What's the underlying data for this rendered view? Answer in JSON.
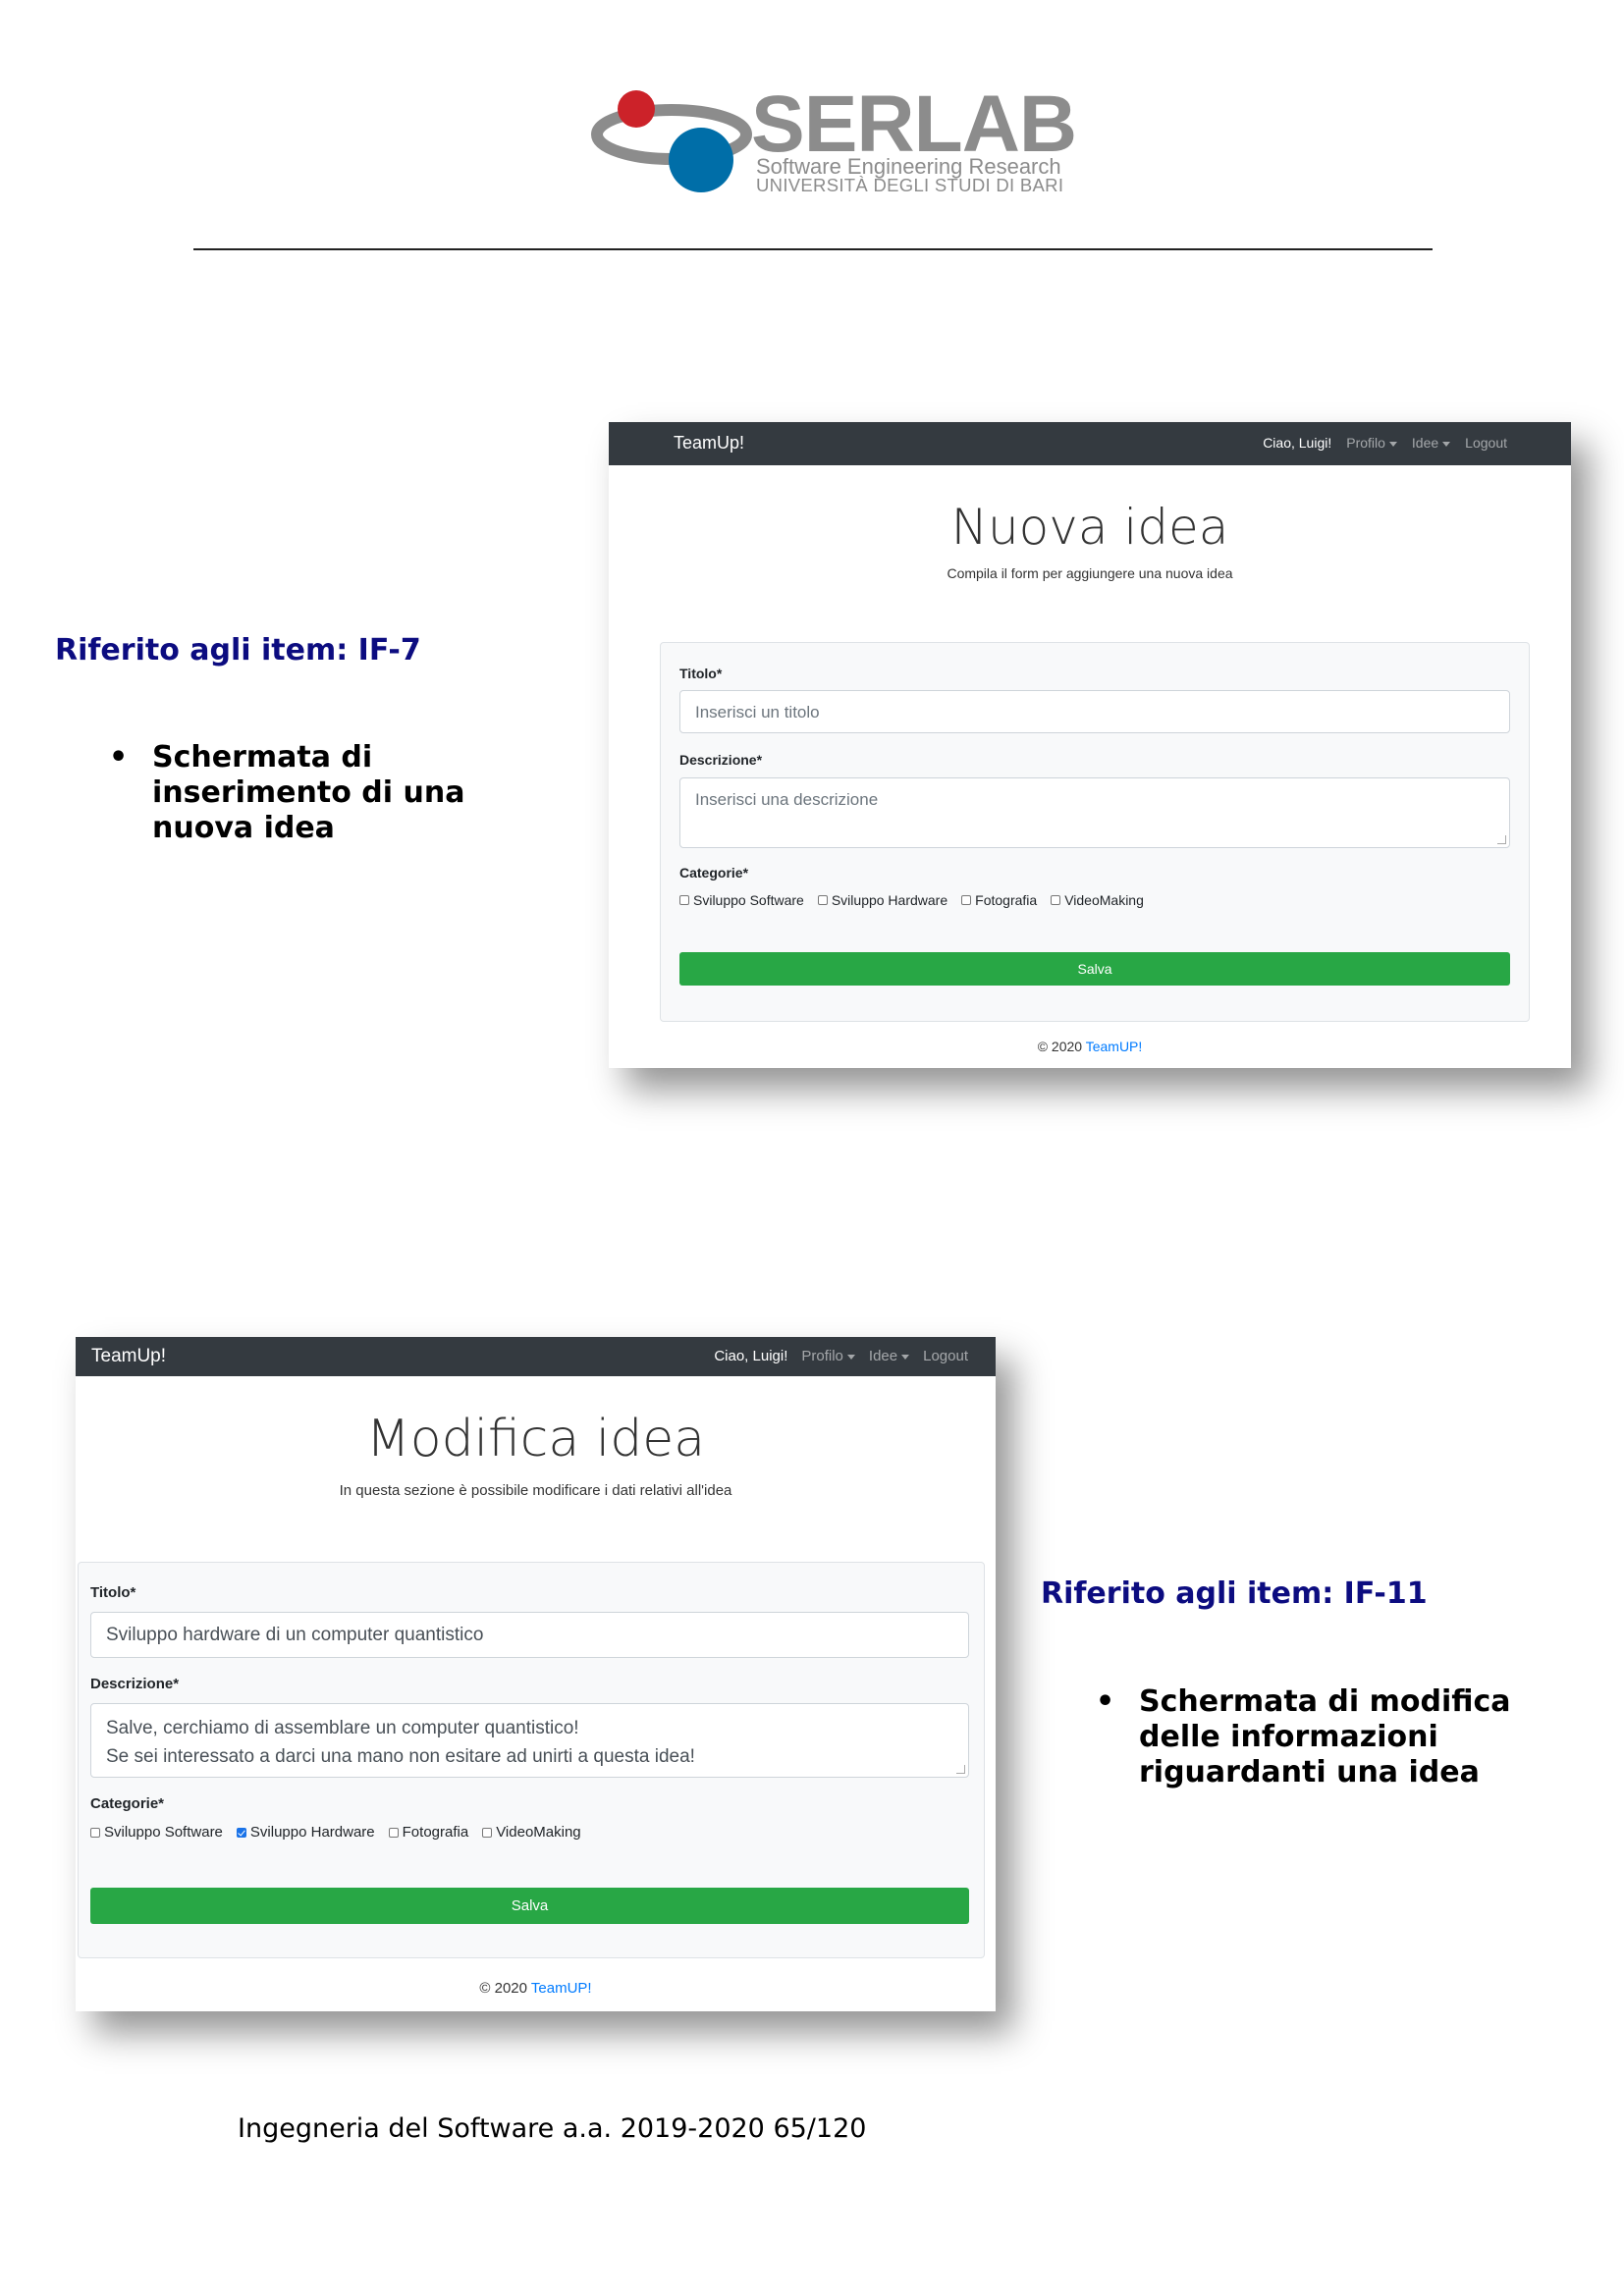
{
  "logo": {
    "name": "SERLAB",
    "subtitle_1": "Software Engineering Research",
    "subtitle_2": "UNIVERSITÀ DEGLI STUDI DI BARI",
    "colors": {
      "red": "#cc2229",
      "blue": "#006ea8",
      "gray": "#8c8c8c"
    }
  },
  "section_1": {
    "ref_label": "Riferito agli item: IF-7",
    "bullet": "Schermata di inserimento di una nuova idea"
  },
  "section_2": {
    "ref_label": "Riferito agli item: IF-11",
    "bullet": "Schermata di modifica delle informazioni riguardanti una idea"
  },
  "screenshot_1": {
    "navbar": {
      "brand": "TeamUp!",
      "greeting": "Ciao, Luigi!",
      "profile": "Profilo",
      "ideas": "Idee",
      "logout": "Logout"
    },
    "heading": "Nuova idea",
    "lead": "Compila il form per aggiungere una nuova idea",
    "form": {
      "title_label": "Titolo*",
      "title_placeholder": "Inserisci un titolo",
      "description_label": "Descrizione*",
      "description_placeholder": "Inserisci una descrizione",
      "categories_label": "Categorie*",
      "categories": [
        {
          "label": "Sviluppo Software",
          "checked": false
        },
        {
          "label": "Sviluppo Hardware",
          "checked": false
        },
        {
          "label": "Fotografia",
          "checked": false
        },
        {
          "label": "VideoMaking",
          "checked": false
        }
      ],
      "submit_label": "Salva"
    },
    "footer": {
      "copyright": "© 2020",
      "link": "TeamUP!"
    }
  },
  "screenshot_2": {
    "navbar": {
      "brand": "TeamUp!",
      "greeting": "Ciao, Luigi!",
      "profile": "Profilo",
      "ideas": "Idee",
      "logout": "Logout"
    },
    "heading": "Modifica idea",
    "lead": "In questa sezione è possibile modificare i dati relativi all'idea",
    "form": {
      "title_label": "Titolo*",
      "title_value": "Sviluppo hardware di un computer quantistico",
      "description_label": "Descrizione*",
      "description_line_1": "Salve, cerchiamo di assemblare un computer quantistico!",
      "description_line_2": "Se sei interessato a darci una mano non esitare ad unirti a questa idea!",
      "categories_label": "Categorie*",
      "categories": [
        {
          "label": "Sviluppo Software",
          "checked": false
        },
        {
          "label": "Sviluppo Hardware",
          "checked": true
        },
        {
          "label": "Fotografia",
          "checked": false
        },
        {
          "label": "VideoMaking",
          "checked": false
        }
      ],
      "submit_label": "Salva"
    },
    "footer": {
      "copyright": "© 2020",
      "link": "TeamUP!"
    }
  },
  "page_footer": "Ingegneria del Software a.a. 2019-2020 65/120"
}
